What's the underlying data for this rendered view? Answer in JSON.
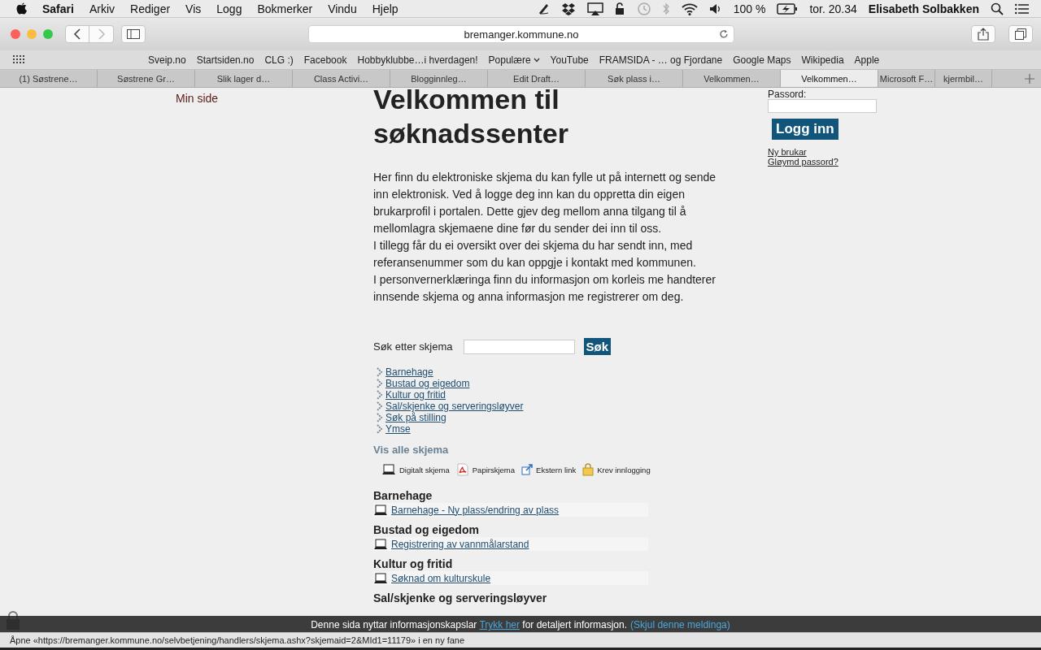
{
  "menubar": {
    "app": "Safari",
    "menus": [
      "Arkiv",
      "Rediger",
      "Vis",
      "Logg",
      "Bokmerker",
      "Vindu",
      "Hjelp"
    ],
    "battery": "100 %",
    "clock": "tor. 20.34",
    "user": "Elisabeth Solbakken"
  },
  "toolbar": {
    "url": "bremanger.kommune.no"
  },
  "bookmarks": [
    {
      "label": "Sveip.no",
      "kind": "link"
    },
    {
      "label": "Startsiden.no",
      "kind": "link"
    },
    {
      "label": "CLG :)",
      "kind": "link"
    },
    {
      "label": "Facebook",
      "kind": "link"
    },
    {
      "label": "Hobbyklubbe…i hverdagen!",
      "kind": "link"
    },
    {
      "label": "Populære",
      "kind": "folder"
    },
    {
      "label": "YouTube",
      "kind": "link"
    },
    {
      "label": "FRAMSIDA - … og Fjordane",
      "kind": "link"
    },
    {
      "label": "Google Maps",
      "kind": "link"
    },
    {
      "label": "Wikipedia",
      "kind": "link"
    },
    {
      "label": "Apple",
      "kind": "link"
    }
  ],
  "tabs": [
    {
      "label": "(1) Søstrene…",
      "selected": false
    },
    {
      "label": "Søstrene Gr…",
      "selected": false
    },
    {
      "label": "Slik lager d…",
      "selected": false
    },
    {
      "label": "Class Activi…",
      "selected": false
    },
    {
      "label": "Blogginnleg…",
      "selected": false
    },
    {
      "label": "Edit Draft…",
      "selected": false
    },
    {
      "label": "Søk plass i…",
      "selected": false
    },
    {
      "label": "Velkommen…",
      "selected": false
    },
    {
      "label": "Velkommen…",
      "selected": true
    },
    {
      "label": "Microsoft F…",
      "selected": false
    },
    {
      "label": "kjermbil…",
      "selected": false
    }
  ],
  "sidebar": {
    "link": "Min side"
  },
  "main": {
    "title": "Velkommen til søknadssenter",
    "intro": [
      "Her finn du elektroniske skjema du kan fylle ut på internett og sende inn elektronisk.  Ved å logge deg inn kan du oppretta din eigen brukarprofil i portalen. Dette gjev deg mellom anna tilgang til å mellomlagra skjemaene dine før du sender dei inn til oss.",
      "I tillegg får du ei oversikt over dei skjema du har sendt inn, med referansenummer som du kan oppgje i kontakt med kommunen.",
      "I personvernerklæringa finn du informasjon om korleis me handterer innsende skjema og anna informasjon me registrerer om deg."
    ],
    "search": {
      "label": "Søk etter skjema",
      "button": "Søk"
    },
    "categories": [
      "Barnehage",
      "Bustad og eigedom",
      "Kultur og fritid",
      "Sal/skjenke og serveringsløyver",
      "Søk på stilling",
      "Ymse"
    ],
    "show_all": "Vis alle skjema",
    "legend": [
      {
        "kind": "digital",
        "label": "Digitalt skjema"
      },
      {
        "kind": "paper",
        "label": "Papirskjema"
      },
      {
        "kind": "external",
        "label": "Ekstern link"
      },
      {
        "kind": "login",
        "label": "Krev innlogging"
      }
    ],
    "sections": [
      {
        "heading": "Barnehage",
        "forms": [
          "Barnehage - Ny plass/endring av plass"
        ]
      },
      {
        "heading": "Bustad og eigedom",
        "forms": [
          "Registrering av vannmålarstand"
        ]
      },
      {
        "heading": "Kultur og fritid",
        "forms": [
          "Søknad om kulturskule"
        ]
      },
      {
        "heading": "Sal/skjenke og serveringsløyver"
      }
    ]
  },
  "login": {
    "password_label": "Passord:",
    "button": "Logg inn",
    "links": [
      "Ny brukar",
      "Gløymd passord?"
    ]
  },
  "cookie_bar": {
    "text": "Denne sida nyttar informasjonskapslar",
    "link": "Trykk her",
    "after": "for detaljert informasjon.",
    "dismiss": "(Skjul denne meldinga)"
  },
  "status_bar": "Åpne «https://bremanger.kommune.no/selvbetjening/handlers/skjema.ashx?skjemaid=2&MId1=11179» i en ny fane"
}
